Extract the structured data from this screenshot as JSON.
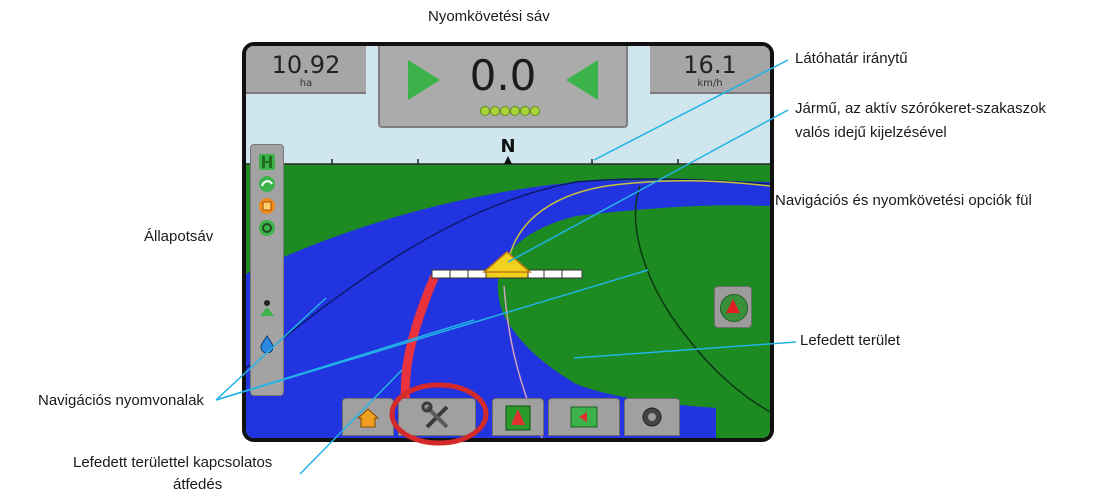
{
  "callouts": {
    "guidance_bar": "Nyomkövetési sáv",
    "horizon_compass": "Látóhatár iránytű",
    "vehicle_line1": "Jármű, az aktív szórókeret-szakaszok",
    "vehicle_line2": "valós idejű kijelzésével",
    "nav_options_tab": "Navigációs és nyomkövetési opciók fül",
    "status_bar": "Állapotsáv",
    "applied_area": "Lefedett terület",
    "guidance_lines": "Navigációs nyomvonalak",
    "overlap_line1": "Lefedett területtel kapcsolatos",
    "overlap_line2": "átfedés"
  },
  "screen": {
    "area": {
      "value": "10.92",
      "unit": "ha"
    },
    "speed": {
      "value": "16.1",
      "unit": "km/h"
    },
    "lightbar": {
      "deviation": "0.0",
      "led_count": 6
    },
    "compass": {
      "heading": "N"
    }
  },
  "status_icons": [
    "boom-status-icon",
    "gnss-status-icon",
    "section-control-icon",
    "steering-status-icon",
    "vehicle-indicator-icon",
    "tank-level-icon"
  ],
  "bottom_tabs": [
    {
      "name": "home-tab",
      "icon": "home-icon"
    },
    {
      "name": "tools-tab",
      "icon": "wrench-screwdriver-icon",
      "highlighted": true
    },
    {
      "name": "guidance-tab",
      "icon": "guidance-view-icon"
    },
    {
      "name": "field-map-tab",
      "icon": "field-map-icon"
    },
    {
      "name": "camera-tab",
      "icon": "camera-icon"
    }
  ],
  "colors": {
    "field_green": "#1e8a22",
    "applied_blue": "#2233e0",
    "sky": "#cfe6ef",
    "callout_line": "#22b3e6",
    "highlight_ring": "#d42a2a",
    "overlap_red": "#e8333f",
    "arrow_green": "#3cb34a"
  }
}
